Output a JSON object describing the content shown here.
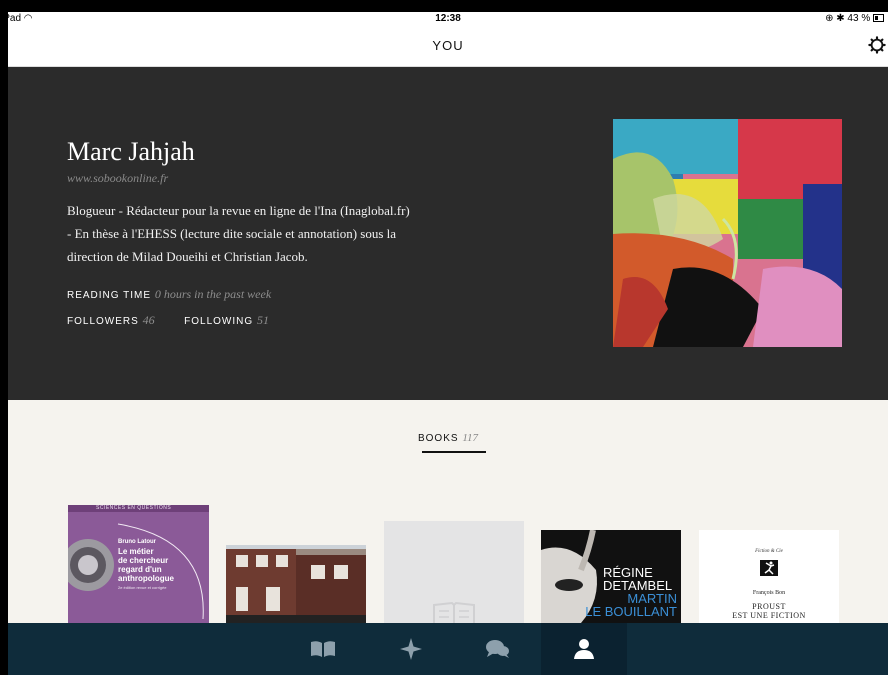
{
  "status_bar": {
    "device": "iPad",
    "time": "12:38",
    "battery": "43 %"
  },
  "header": {
    "title": "YOU"
  },
  "profile": {
    "name": "Marc Jahjah",
    "website": "www.sobookonline.fr",
    "bio_lines": [
      "Blogueur - Rédacteur pour la revue en ligne de l'Ina (Inaglobal.fr)",
      "- En thèse à l'EHESS (lecture dite sociale et annotation) sous la",
      "direction de Milad Doueihi et Christian Jacob."
    ],
    "reading_time_label": "READING TIME",
    "reading_time_value": "0 hours in the past week",
    "followers_label": "FOLLOWERS",
    "followers_count": "46",
    "following_label": "FOLLOWING",
    "following_count": "51"
  },
  "books": {
    "tab_label": "BOOKS",
    "count": "117",
    "items": [
      {
        "series": "SCIENCES EN QUESTIONS",
        "author": "Bruno Latour",
        "title_lines": [
          "Le métier",
          "de chercheur",
          "regard d'un",
          "anthropologue"
        ],
        "edition": "2e édition revue et corrigée"
      },
      {
        "title": ""
      },
      {
        "title": ""
      },
      {
        "author_lines": [
          "RÉGINE",
          "DETAMBEL"
        ],
        "title_lines": [
          "MARTIN",
          "LE BOUILLANT"
        ]
      },
      {
        "publisher": "Fiction & Cie",
        "author": "François Bon",
        "title_lines": [
          "PROUST",
          "EST UNE FICTION"
        ]
      }
    ]
  },
  "tab_bar": {
    "tabs": [
      {
        "icon": "book-icon",
        "active": false
      },
      {
        "icon": "compass-icon",
        "active": false
      },
      {
        "icon": "chat-bubbles-icon",
        "active": false
      },
      {
        "icon": "person-icon",
        "active": true
      }
    ]
  },
  "colors": {
    "hero_bg": "#2b2b2b",
    "tabbar_bg": "#0f2c3b",
    "page_bg": "#f5f3ee"
  }
}
